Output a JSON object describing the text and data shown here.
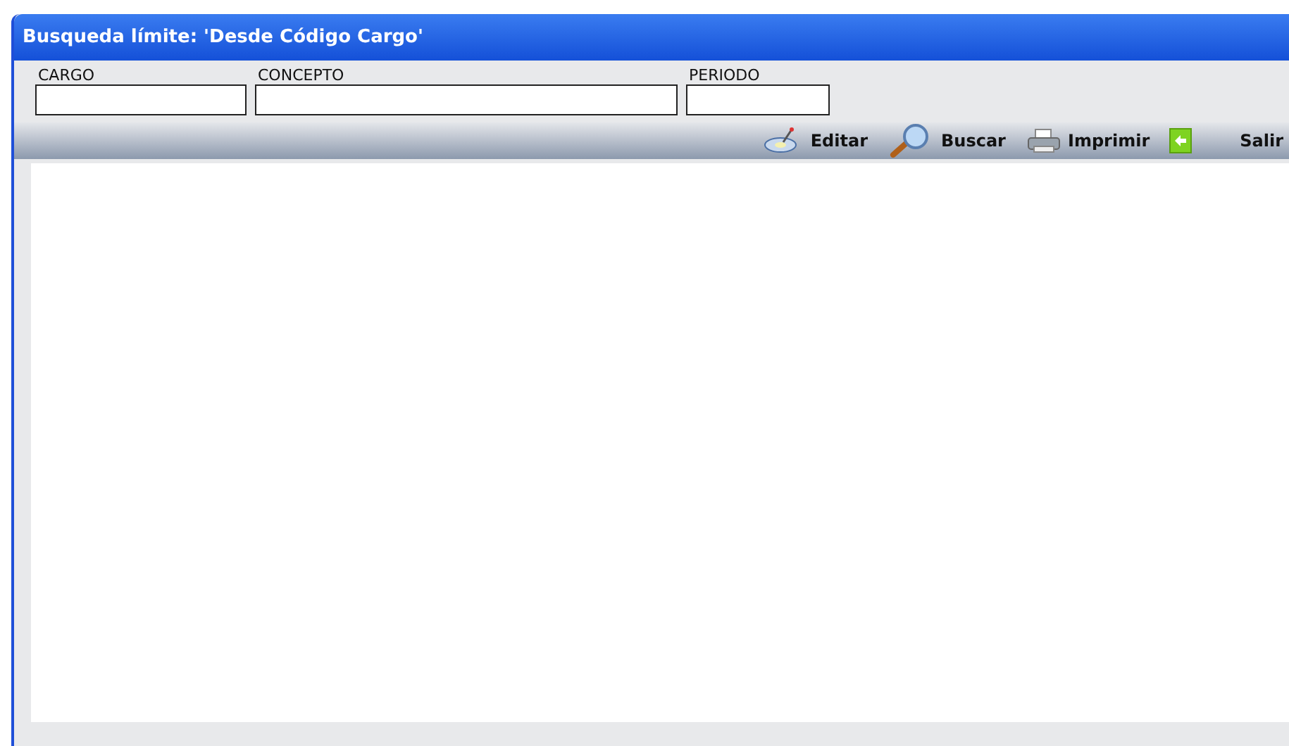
{
  "window": {
    "title": "Busqueda límite: 'Desde Código Cargo'"
  },
  "fields": [
    {
      "label": "CARGO"
    },
    {
      "label": "CONCEPTO"
    },
    {
      "label": "PERIODO"
    }
  ],
  "toolbar": [
    {
      "kind": "edit",
      "label": "Editar"
    },
    {
      "kind": "search",
      "label": "Buscar"
    },
    {
      "kind": "print",
      "label": "Imprimir"
    },
    {
      "kind": "exit",
      "label": "Salir"
    }
  ]
}
